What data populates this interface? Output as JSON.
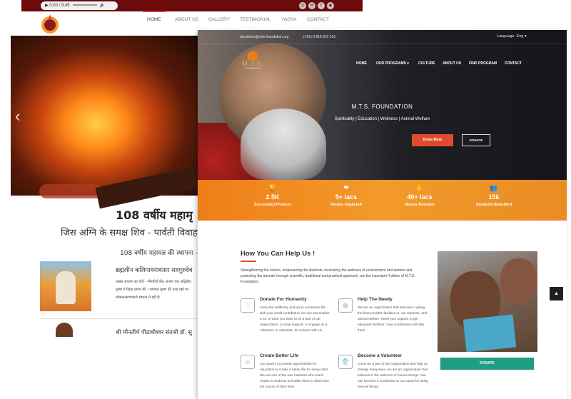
{
  "back": {
    "audio": {
      "time": "0:00 / 9:45"
    },
    "nav": [
      "HOME",
      "ABOUT US",
      "GALLERY",
      "TESTIMONIAL",
      "YAGYA",
      "CONTACT"
    ],
    "heading": "108 वर्षीय महामृ",
    "subheading": "जिस अग्नि के समक्ष शिव - पार्वती विवाह हु",
    "line": "108 वर्षीय महायज्ञ की स्थापना - गु",
    "profile_title": "ब्रह्मलीन कलिपावनावतार सदगुरुदेव",
    "profile_body": [
      "अखंड साधना का तीर्थ - मौनतीर्थ पीठ आश्रम एक अद्वितीय",
      "कृष्ण ने किया प्रारंभ की । भगवान कृष्ण की तरह यहाँ पर",
      "लोककल्याणकारी साधना में रही है।"
    ],
    "line2": "श्री मौनतीर्थ पीठाधीश्वर संतश्री डॉ. सु"
  },
  "front": {
    "email": "donations@mts-foundation.org",
    "phone": "(+91) 8 818 815 515",
    "language": "Language: Eng ▾",
    "logo": {
      "mts": "M.T.S.",
      "foundation": "FOUNDATION"
    },
    "nav": [
      "HOME",
      "OUR PROGRAMS ▾",
      "CULTURE",
      "ABOUT US",
      "FIND PROGRAM",
      "CONTACT"
    ],
    "hero_title": "M.T.S. FOUNDATION",
    "hero_tagline": "Spirituality | Education | Wellness | Animal Welfare",
    "know_more": "Know More",
    "donate": "DONATE",
    "stats": [
      {
        "icon": "trophy-icon",
        "glyph": "🏆",
        "num": "2.5K",
        "label": "Successful Projects"
      },
      {
        "icon": "heart-hand-icon",
        "glyph": "❤",
        "num": "5+ lacs",
        "label": "People Impacted"
      },
      {
        "icon": "money-icon",
        "glyph": "✋",
        "num": "40+ lacs",
        "label": "Money Donated"
      },
      {
        "icon": "students-icon",
        "glyph": "👥",
        "num": "15k",
        "label": "Students Benefited"
      }
    ],
    "help_title": "How You Can Help Us !",
    "help_intro": "Strengthening the culture, empowering the students, increasing the wellness of environment and women and protecting the animals through scientific, traditional and practical approach, are the important 4 pillars of M.T.S. Foundation.",
    "cards": [
      {
        "title": "Donate For Humanity",
        "icon": "hand-heart-icon",
        "glyph": "♡",
        "body": "Carry the wellbeing and joy to someones life with your small contribution we can accomplish a lot. In case you want to be a part of our organization, to raise support, or engage as a volunteer, or assistant, do connect with us."
      },
      {
        "title": "Help The Needy",
        "icon": "globe-icon",
        "glyph": "⊕",
        "body": "We are an organization that believes in giving the best possible facilities to, our students, and animal welfare. Need your support to get adequate facilities. Your contribution will help them."
      },
      {
        "title": "Create Better Life",
        "icon": "people-icon",
        "glyph": "☺",
        "body": "Our goal is to provide opportunities for education to create a better life for every child. We are one of the rare institutes who teach Vedas to students to enable them to determine the course of their lives."
      },
      {
        "title": "Become a Volunteer",
        "icon": "tshirt-icon",
        "glyph": "👕",
        "body": "Come be a part of our organization and help us change many lives, we are an organization that believes in the wellness of human beings. You can become a contributor to our cause by doing several things."
      }
    ],
    "donate2": "DONATE"
  },
  "scroll_top": "▲"
}
